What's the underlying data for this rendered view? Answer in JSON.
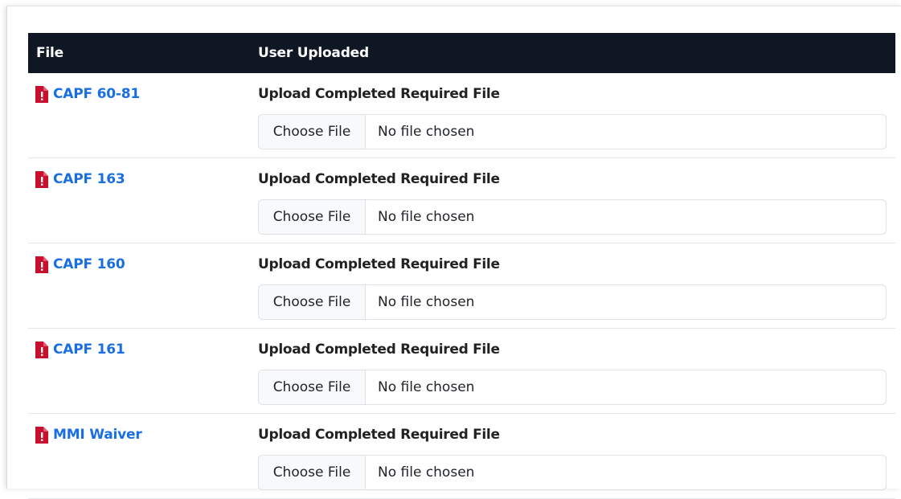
{
  "table": {
    "headers": {
      "file": "File",
      "user_uploaded": "User Uploaded"
    },
    "rows": [
      {
        "file_name": "CAPF 60-81",
        "upload_label": "Upload Completed Required File",
        "choose_button": "Choose File",
        "file_status": "No file chosen"
      },
      {
        "file_name": "CAPF 163",
        "upload_label": "Upload Completed Required File",
        "choose_button": "Choose File",
        "file_status": "No file chosen"
      },
      {
        "file_name": "CAPF 160",
        "upload_label": "Upload Completed Required File",
        "choose_button": "Choose File",
        "file_status": "No file chosen"
      },
      {
        "file_name": "CAPF 161",
        "upload_label": "Upload Completed Required File",
        "choose_button": "Choose File",
        "file_status": "No file chosen"
      },
      {
        "file_name": "MMI Waiver",
        "upload_label": "Upload Completed Required File",
        "choose_button": "Choose File",
        "file_status": "No file chosen"
      }
    ]
  },
  "colors": {
    "header_bg": "#0f1724",
    "link": "#1a6fe0",
    "pdf_icon": "#c8102e"
  },
  "icons": {
    "file_type": "pdf-file-icon"
  }
}
